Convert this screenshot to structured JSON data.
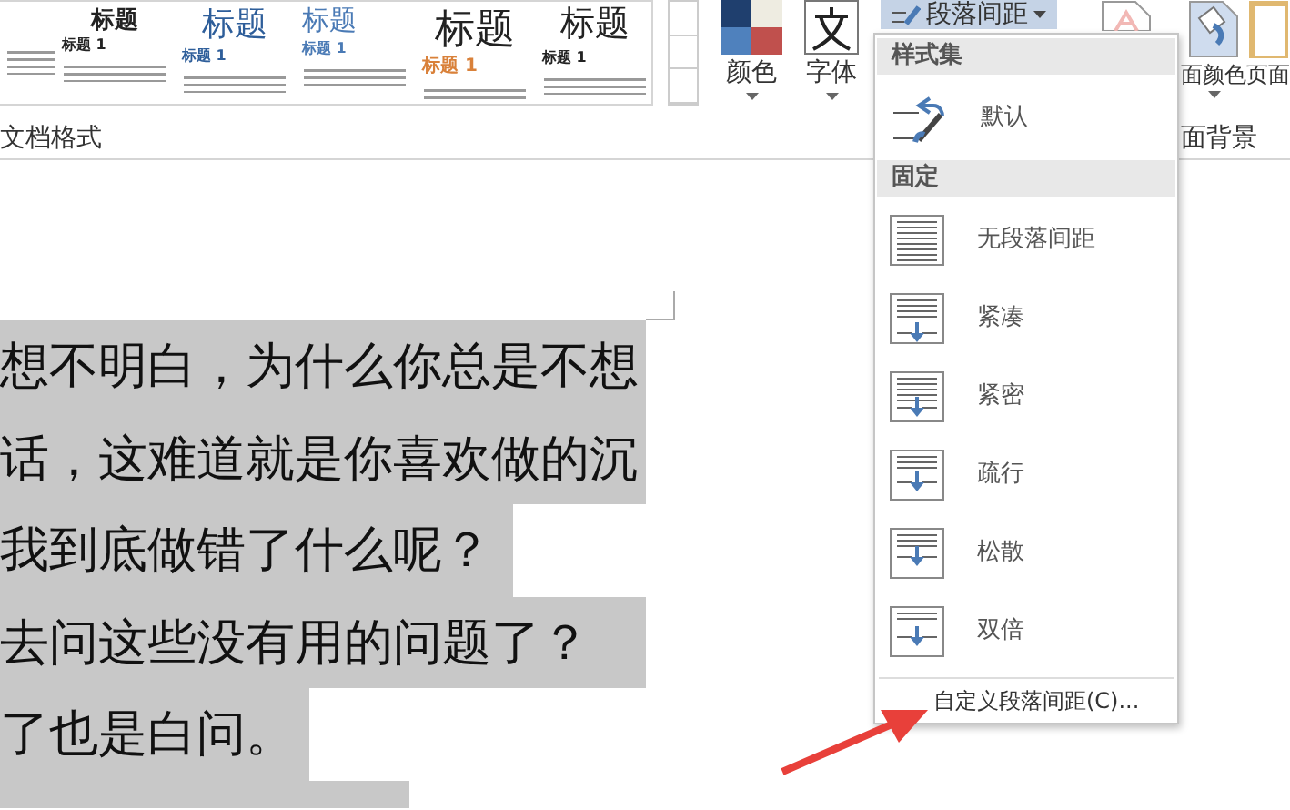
{
  "ribbon": {
    "style_gallery": [
      {
        "kind": "partial"
      },
      {
        "kind": "plain",
        "heading": "标题",
        "subheading": "标题 1"
      },
      {
        "kind": "blue",
        "heading": "标题",
        "subheading": "标题 1"
      },
      {
        "kind": "blue-small",
        "heading": "标题",
        "subheading": "标题 1"
      },
      {
        "kind": "large-orange",
        "heading": "标题",
        "subheading": "标题 1"
      },
      {
        "kind": "large",
        "heading": "标题",
        "subheading": "标题 1"
      }
    ],
    "buttons": [
      {
        "kind": "colors",
        "label": "颜色"
      },
      {
        "kind": "fonts",
        "label": "字体"
      }
    ],
    "paragraph_spacing": {
      "label": "段落间距",
      "expanded": true
    },
    "background_buttons": [
      {
        "kind": "watermark"
      },
      {
        "kind": "page-color",
        "label": "面颜色"
      },
      {
        "kind": "page-border",
        "label": "页面"
      }
    ],
    "group_labels": [
      "文档格式",
      "面背景"
    ]
  },
  "dropdown": {
    "sections": [
      {
        "header": "样式集",
        "items": [
          {
            "kind": "default",
            "label": "默认"
          }
        ]
      },
      {
        "header": "固定",
        "items": [
          {
            "kind": "none",
            "label": "无段落间距"
          },
          {
            "kind": "compact",
            "label": "紧凑"
          },
          {
            "kind": "tight",
            "label": "紧密"
          },
          {
            "kind": "open",
            "label": "疏行"
          },
          {
            "kind": "relaxed",
            "label": "松散"
          },
          {
            "kind": "double",
            "label": "双倍"
          }
        ]
      }
    ],
    "footer": "自定义段落间距(C)..."
  },
  "document": {
    "lines": [
      {
        "text": "想不明白，为什么你总是不想"
      },
      {
        "text": "话，这难道就是你喜欢做的沉"
      },
      {
        "text": "我到底做错了什么呢？"
      },
      {
        "text": "去问这些没有用的问题了？"
      },
      {
        "text": "了也是白问。"
      }
    ]
  }
}
